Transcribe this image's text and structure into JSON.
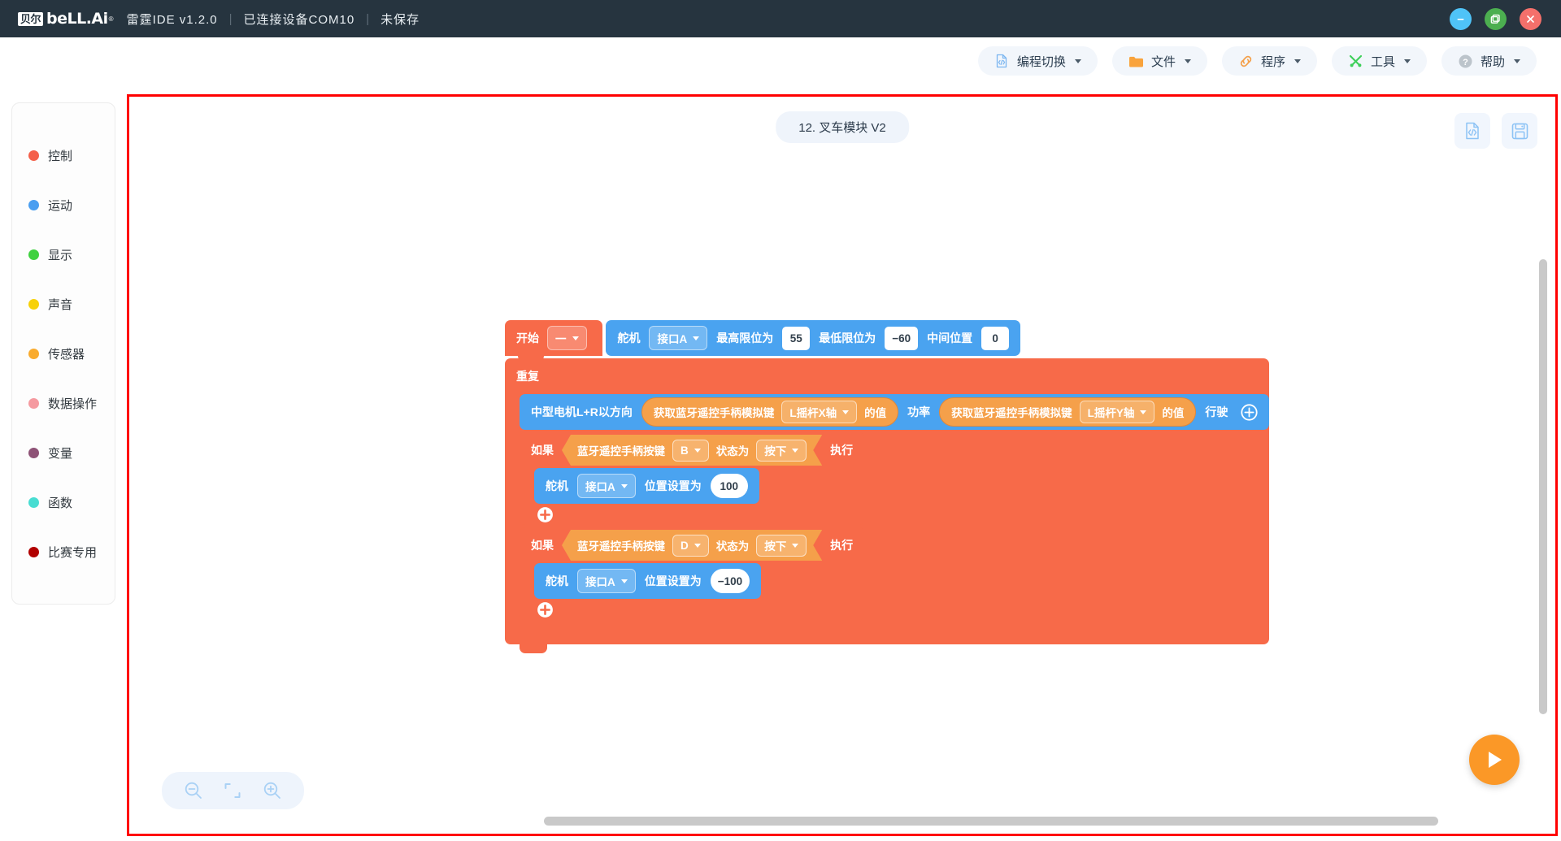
{
  "titlebar": {
    "logo_badge": "贝尔",
    "logo_word": "beLL.Ai",
    "app_name": "雷霆IDE v1.2.0",
    "device_status": "已连接设备COM10",
    "save_status": "未保存",
    "sep": "|",
    "window_controls": [
      {
        "name": "minimize",
        "icon": "minus-icon",
        "color": "#4fc3f7"
      },
      {
        "name": "maximize",
        "icon": "restore-icon",
        "color": "#4caf50"
      },
      {
        "name": "close",
        "icon": "close-icon",
        "color": "#f4706b"
      }
    ]
  },
  "menubar": {
    "items": [
      {
        "label": "编程切换",
        "icon": "code-file-icon",
        "color": "#7bb6f0"
      },
      {
        "label": "文件",
        "icon": "folder-icon",
        "color": "#f9a33c"
      },
      {
        "label": "程序",
        "icon": "link-icon",
        "color": "#f4a04a"
      },
      {
        "label": "工具",
        "icon": "tools-icon",
        "color": "#3ecf5a"
      },
      {
        "label": "帮助",
        "icon": "question-circle-icon",
        "color": "#bcc4cb"
      }
    ]
  },
  "sidebar": {
    "items": [
      {
        "label": "控制",
        "color": "#f4604a"
      },
      {
        "label": "运动",
        "color": "#4a9ef0"
      },
      {
        "label": "显示",
        "color": "#3fd13f"
      },
      {
        "label": "声音",
        "color": "#f7d108"
      },
      {
        "label": "传感器",
        "color": "#f9ab2e"
      },
      {
        "label": "数据操作",
        "color": "#f59aa0"
      },
      {
        "label": "变量",
        "color": "#8e5276"
      },
      {
        "label": "函数",
        "color": "#48ddd2"
      },
      {
        "label": "比赛专用",
        "color": "#b10000"
      }
    ]
  },
  "canvas": {
    "title": "12. 叉车模块 V2",
    "highlight_border_color": "#ff0000",
    "tools": [
      {
        "name": "view-code",
        "icon": "code-file-icon"
      },
      {
        "name": "save-project",
        "icon": "floppy-save-icon"
      }
    ],
    "zoom_controls": [
      {
        "name": "zoom-out",
        "icon": "magnifier-minus-icon"
      },
      {
        "name": "fit-to-screen",
        "icon": "fit-screen-icon"
      },
      {
        "name": "zoom-in",
        "icon": "magnifier-plus-icon"
      }
    ],
    "run_button": {
      "name": "run-program",
      "icon": "play-icon",
      "color": "#fb9827"
    }
  },
  "program": {
    "start": {
      "label": "开始",
      "dropdown": "一"
    },
    "servo_init": {
      "label": "舵机",
      "port": "接口A",
      "max_label": "最高限位为",
      "max_value": "55",
      "min_label": "最低限位为",
      "min_value": "−60",
      "mid_label": "中间位置",
      "mid_value": "0"
    },
    "repeat": {
      "label": "重复"
    },
    "drive": {
      "label": "中型电机L+R以方向",
      "x_reporter": {
        "label": "获取蓝牙遥控手柄模拟键",
        "axis": "L摇杆X轴",
        "suffix": "的值"
      },
      "power_label": "功率",
      "y_reporter": {
        "label": "获取蓝牙遥控手柄模拟键",
        "axis": "L摇杆Y轴",
        "suffix": "的值"
      },
      "tail_label": "行驶",
      "add_icon": "plus-circle-icon"
    },
    "if_blocks": [
      {
        "if_label": "如果",
        "condition": {
          "label": "蓝牙遥控手柄按键",
          "key": "B",
          "state_label": "状态为",
          "state": "按下"
        },
        "then_label": "执行",
        "statement": {
          "label": "舵机",
          "port": "接口A",
          "action_label": "位置设置为",
          "value": "100"
        },
        "add_icon": "plus-circle-icon"
      },
      {
        "if_label": "如果",
        "condition": {
          "label": "蓝牙遥控手柄按键",
          "key": "D",
          "state_label": "状态为",
          "state": "按下"
        },
        "then_label": "执行",
        "statement": {
          "label": "舵机",
          "port": "接口A",
          "action_label": "位置设置为",
          "value": "−100"
        },
        "add_icon": "plus-circle-icon"
      }
    ]
  }
}
